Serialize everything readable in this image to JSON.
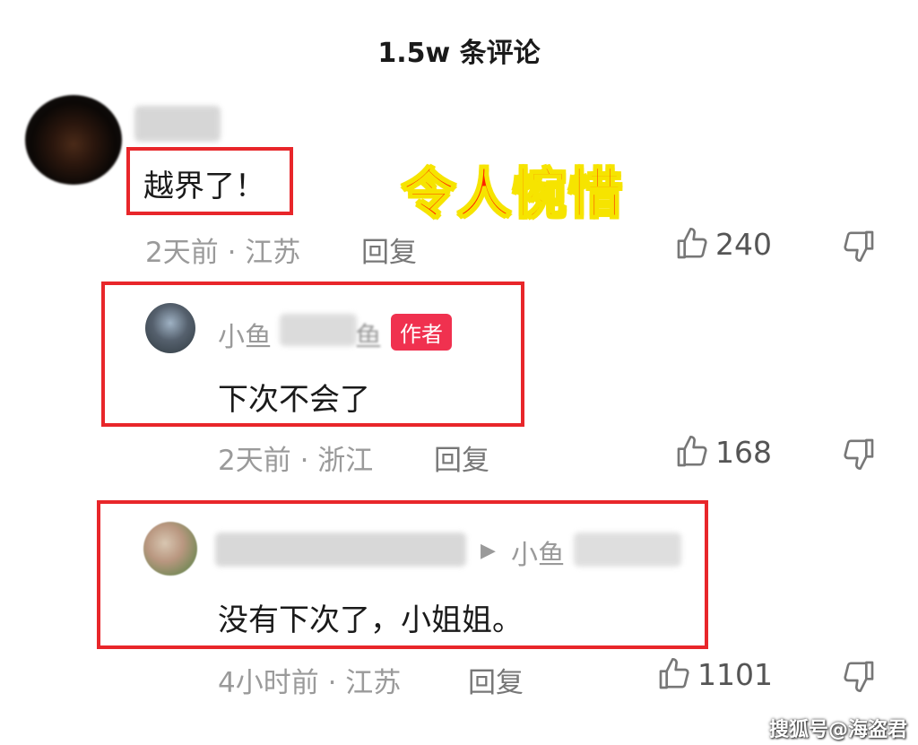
{
  "header": {
    "title": "1.5w 条评论"
  },
  "overlay": {
    "text": "令人惋惜"
  },
  "comments": [
    {
      "text": "越界了！",
      "time_location": "2天前 · 江苏",
      "reply_label": "回复",
      "likes": "240"
    },
    {
      "name_prefix": "小鱼",
      "name_suffix": "鱼",
      "badge": "作者",
      "text": "下次不会了",
      "time_location": "2天前 · 浙江",
      "reply_label": "回复",
      "likes": "168"
    },
    {
      "reply_to_name": "小鱼",
      "text": "没有下次了，小姐姐。",
      "time_location": "4小时前 · 江苏",
      "reply_label": "回复",
      "likes": "1101"
    }
  ],
  "watermark": "搜狐号@海盗君",
  "colors": {
    "highlight_box": "#e8262a",
    "author_badge": "#f0314f",
    "overlay_text": "#ff2300",
    "overlay_stroke": "#f6e400"
  },
  "icons": [
    "thumbs-up-icon",
    "thumbs-down-icon",
    "reply-arrow-icon"
  ]
}
